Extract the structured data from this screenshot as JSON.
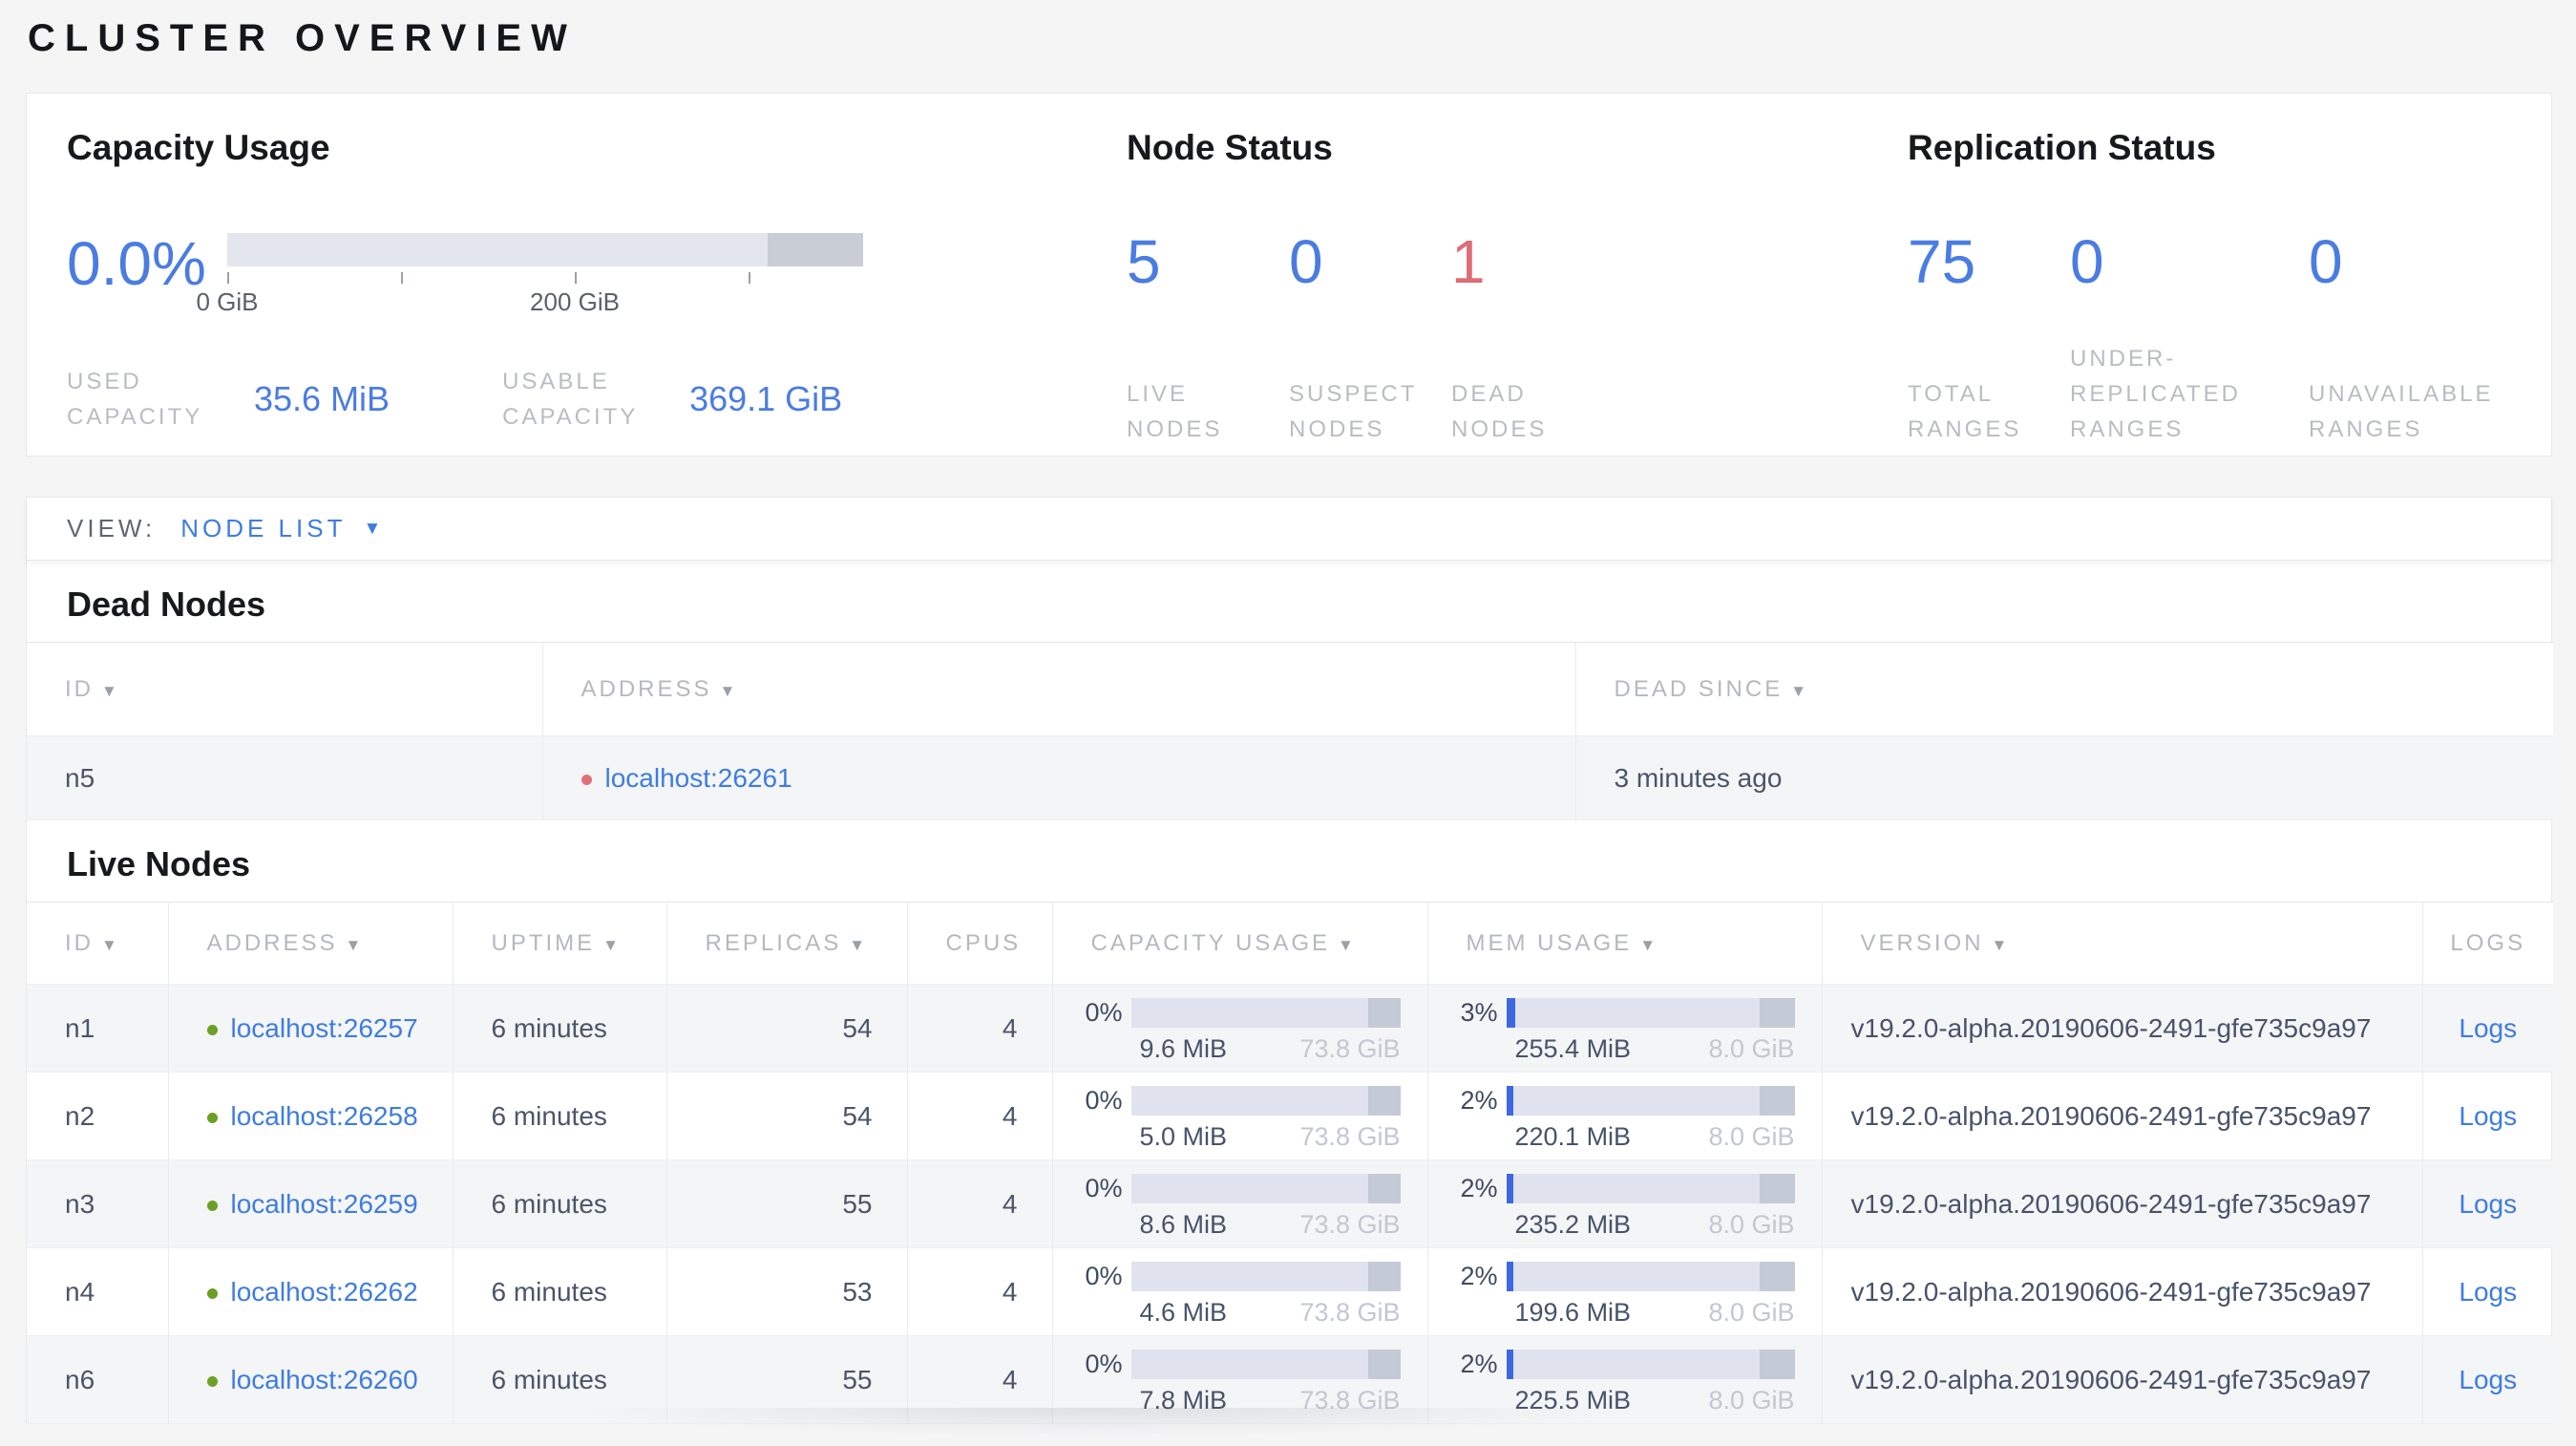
{
  "page": {
    "title": "CLUSTER OVERVIEW"
  },
  "icons": {
    "sort_desc": "▼",
    "dropdown_caret": "▼"
  },
  "colors": {
    "accent_blue": "#4a7ce2",
    "link_blue": "#3e7ce2",
    "danger_red": "#de6c75",
    "live_dot_green": "#6ba024",
    "dead_dot_red": "#e2707a"
  },
  "summary": {
    "capacity": {
      "heading": "Capacity Usage",
      "percent": "0.0%",
      "bar": {
        "fill_percent": 0,
        "reserved_right_percent": 15,
        "tick_labels": [
          "0 GiB",
          "200 GiB"
        ]
      },
      "used": {
        "label": "USED CAPACITY",
        "value": "35.6 MiB"
      },
      "usable": {
        "label": "USABLE CAPACITY",
        "value": "369.1 GiB"
      }
    },
    "node_status": {
      "heading": "Node Status",
      "metrics": [
        {
          "value": "5",
          "label": "LIVE\nNODES"
        },
        {
          "value": "0",
          "label": "SUSPECT\nNODES"
        },
        {
          "value": "1",
          "label": "DEAD\nNODES"
        }
      ]
    },
    "replication": {
      "heading": "Replication Status",
      "metrics": [
        {
          "value": "75",
          "label": "TOTAL\nRANGES"
        },
        {
          "value": "0",
          "label": "UNDER-\nREPLICATED\nRANGES"
        },
        {
          "value": "0",
          "label": "UNAVAILABLE\nRANGES"
        }
      ]
    }
  },
  "view_bar": {
    "label": "VIEW:",
    "selected": "NODE LIST"
  },
  "dead_nodes": {
    "heading": "Dead Nodes",
    "columns": [
      {
        "label": "ID",
        "sortable": true
      },
      {
        "label": "ADDRESS",
        "sortable": true
      },
      {
        "label": "DEAD SINCE",
        "sortable": true
      }
    ],
    "rows": [
      {
        "id": "n5",
        "address": "localhost:26261",
        "dead_since": "3 minutes ago"
      }
    ]
  },
  "live_nodes": {
    "heading": "Live Nodes",
    "columns": [
      {
        "label": "ID",
        "sortable": true
      },
      {
        "label": "ADDRESS",
        "sortable": true
      },
      {
        "label": "UPTIME",
        "sortable": true
      },
      {
        "label": "REPLICAS",
        "sortable": true
      },
      {
        "label": "CPUS",
        "sortable": false
      },
      {
        "label": "CAPACITY USAGE",
        "sortable": true
      },
      {
        "label": "MEM USAGE",
        "sortable": true
      },
      {
        "label": "VERSION",
        "sortable": true
      },
      {
        "label": "LOGS",
        "sortable": false
      }
    ],
    "rows": [
      {
        "id": "n1",
        "address": "localhost:26257",
        "uptime": "6 minutes",
        "replicas": "54",
        "cpus": "4",
        "capacity": {
          "percent": "0%",
          "fill": 0,
          "used": "9.6 MiB",
          "total": "73.8 GiB"
        },
        "mem": {
          "percent": "3%",
          "fill": 3,
          "used": "255.4 MiB",
          "total": "8.0 GiB"
        },
        "version": "v19.2.0-alpha.20190606-2491-gfe735c9a97",
        "logs": "Logs"
      },
      {
        "id": "n2",
        "address": "localhost:26258",
        "uptime": "6 minutes",
        "replicas": "54",
        "cpus": "4",
        "capacity": {
          "percent": "0%",
          "fill": 0,
          "used": "5.0 MiB",
          "total": "73.8 GiB"
        },
        "mem": {
          "percent": "2%",
          "fill": 2.5,
          "used": "220.1 MiB",
          "total": "8.0 GiB"
        },
        "version": "v19.2.0-alpha.20190606-2491-gfe735c9a97",
        "logs": "Logs"
      },
      {
        "id": "n3",
        "address": "localhost:26259",
        "uptime": "6 minutes",
        "replicas": "55",
        "cpus": "4",
        "capacity": {
          "percent": "0%",
          "fill": 0,
          "used": "8.6 MiB",
          "total": "73.8 GiB"
        },
        "mem": {
          "percent": "2%",
          "fill": 2.5,
          "used": "235.2 MiB",
          "total": "8.0 GiB"
        },
        "version": "v19.2.0-alpha.20190606-2491-gfe735c9a97",
        "logs": "Logs"
      },
      {
        "id": "n4",
        "address": "localhost:26262",
        "uptime": "6 minutes",
        "replicas": "53",
        "cpus": "4",
        "capacity": {
          "percent": "0%",
          "fill": 0,
          "used": "4.6 MiB",
          "total": "73.8 GiB"
        },
        "mem": {
          "percent": "2%",
          "fill": 2.5,
          "used": "199.6 MiB",
          "total": "8.0 GiB"
        },
        "version": "v19.2.0-alpha.20190606-2491-gfe735c9a97",
        "logs": "Logs"
      },
      {
        "id": "n6",
        "address": "localhost:26260",
        "uptime": "6 minutes",
        "replicas": "55",
        "cpus": "4",
        "capacity": {
          "percent": "0%",
          "fill": 0,
          "used": "7.8 MiB",
          "total": "73.8 GiB"
        },
        "mem": {
          "percent": "2%",
          "fill": 2.5,
          "used": "225.5 MiB",
          "total": "8.0 GiB"
        },
        "version": "v19.2.0-alpha.20190606-2491-gfe735c9a97",
        "logs": "Logs"
      }
    ]
  }
}
